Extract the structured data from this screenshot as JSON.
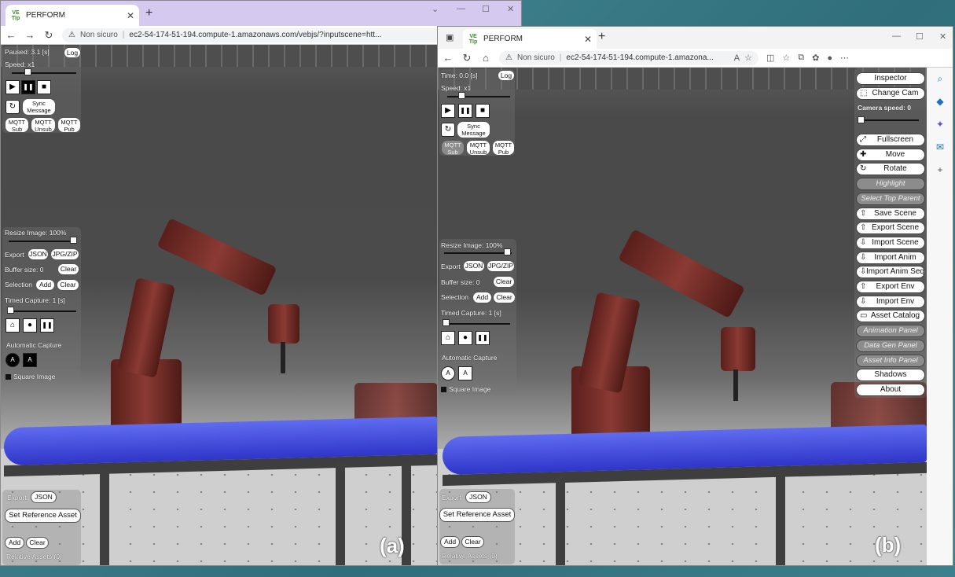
{
  "common": {
    "tab_title": "PERFORM",
    "favicon_text": "VE\nTIp",
    "not_secure": "Non sicuro"
  },
  "windowA": {
    "url": "ec2-54-174-51-194.compute-1.amazonaws.com/vebjs/?inputscene=htt...",
    "status": "Paused: 3.1 [s]",
    "log": "Log",
    "speed": "Speed: x1",
    "caption": "(a)"
  },
  "windowB": {
    "url": "ec2-54-174-51-194.compute-1.amazona...",
    "status": "Time: 0.0 [s]",
    "log": "Log",
    "speed": "Speed: x1",
    "caption": "(b)"
  },
  "controls": {
    "play": "▶",
    "pause": "❚❚",
    "stop": "■",
    "sync_line1": "Sync",
    "sync_line2": "Message",
    "mqtt_sub": [
      "MQTT",
      "Sub"
    ],
    "mqtt_unsub": [
      "MQTT",
      "Unsub"
    ],
    "mqtt_pub": [
      "MQTT",
      "Pub"
    ]
  },
  "capture": {
    "resize": "Resize Image: 100%",
    "export": "Export",
    "json": "JSON",
    "jpgzip": "JPG/ZIP",
    "buffer": "Buffer size: 0",
    "clear": "Clear",
    "selection": "Selection",
    "add": "Add",
    "timed": "Timed Capture: 1 [s]",
    "auto": "Automatic Capture",
    "auto_a1": "A",
    "auto_a2": "A",
    "square": "Square Image"
  },
  "assets": {
    "export": "Export",
    "json": "JSON",
    "set_ref": "Set Reference Asset",
    "add": "Add",
    "clear": "Clear",
    "relative": "Relative Assets (0)"
  },
  "menu": {
    "camera_speed": "Camera speed: 0",
    "items": [
      {
        "label": "Inspector",
        "icon": "",
        "disabled": false
      },
      {
        "label": "Change Cam",
        "icon": "⬚",
        "disabled": false
      },
      {
        "label": "Fullscreen",
        "icon": "⤢",
        "disabled": false
      },
      {
        "label": "Move",
        "icon": "✚",
        "disabled": false
      },
      {
        "label": "Rotate",
        "icon": "↻",
        "disabled": false
      },
      {
        "label": "Highlight",
        "icon": "",
        "disabled": true
      },
      {
        "label": "Select Top Parent",
        "icon": "",
        "disabled": true
      },
      {
        "label": "Save Scene",
        "icon": "⇧",
        "disabled": false
      },
      {
        "label": "Export Scene",
        "icon": "⇧",
        "disabled": false
      },
      {
        "label": "Import Scene",
        "icon": "⇩",
        "disabled": false
      },
      {
        "label": "Import Anim",
        "icon": "⇩",
        "disabled": false
      },
      {
        "label": "Import Anim Seq",
        "icon": "⇩",
        "disabled": false
      },
      {
        "label": "Export Env",
        "icon": "⇧",
        "disabled": false
      },
      {
        "label": "Import Env",
        "icon": "⇩",
        "disabled": false
      },
      {
        "label": "Asset Catalog",
        "icon": "▭",
        "disabled": false
      },
      {
        "label": "Animation Panel",
        "icon": "",
        "disabled": true
      },
      {
        "label": "Data Gen Panel",
        "icon": "",
        "disabled": true
      },
      {
        "label": "Asset Info Panel",
        "icon": "",
        "disabled": true
      },
      {
        "label": "Shadows",
        "icon": "",
        "disabled": false
      },
      {
        "label": "About",
        "icon": "",
        "disabled": false
      }
    ]
  }
}
